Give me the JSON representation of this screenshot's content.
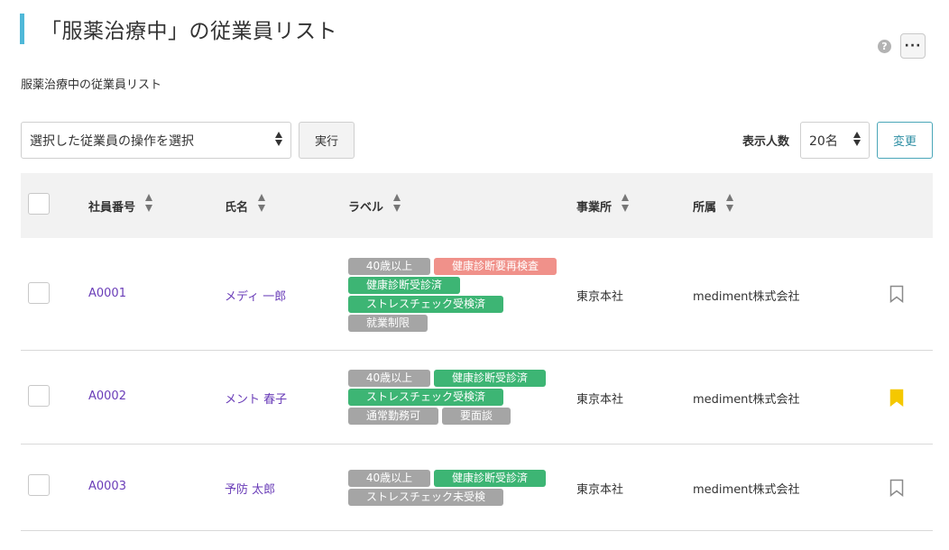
{
  "page": {
    "title": "「服薬治療中」の従業員リスト",
    "subtitle": "服薬治療中の従業員リスト",
    "help_icon": "?",
    "more_label": "···"
  },
  "toolbar": {
    "action_select_value": "選択した従業員の操作を選択",
    "exec_label": "実行",
    "count_label": "表示人数",
    "count_value": "20名",
    "change_label": "変更"
  },
  "table": {
    "headers": {
      "employee_id": "社員番号",
      "name": "氏名",
      "label": "ラベル",
      "office": "事業所",
      "department": "所属"
    },
    "rows": [
      {
        "employee_id": "A0001",
        "name": "メディ 一郎",
        "office": "東京本社",
        "department": "mediment株式会社",
        "bookmarked": false,
        "label_lines": [
          [
            {
              "text": "40歳以上",
              "color": "gray"
            },
            {
              "text": "健康診断要再検査",
              "color": "red"
            }
          ],
          [
            {
              "text": "健康診断受診済",
              "color": "green"
            }
          ],
          [
            {
              "text": "ストレスチェック受検済",
              "color": "green"
            }
          ],
          [
            {
              "text": "就業制限",
              "color": "gray"
            }
          ]
        ]
      },
      {
        "employee_id": "A0002",
        "name": "メント 春子",
        "office": "東京本社",
        "department": "mediment株式会社",
        "bookmarked": true,
        "label_lines": [
          [
            {
              "text": "40歳以上",
              "color": "gray"
            },
            {
              "text": "健康診断受診済",
              "color": "green"
            }
          ],
          [
            {
              "text": "ストレスチェック受検済",
              "color": "green"
            }
          ],
          [
            {
              "text": "通常勤務可",
              "color": "gray"
            },
            {
              "text": "要面談",
              "color": "gray"
            }
          ]
        ]
      },
      {
        "employee_id": "A0003",
        "name": "予防 太郎",
        "office": "東京本社",
        "department": "mediment株式会社",
        "bookmarked": false,
        "label_lines": [
          [
            {
              "text": "40歳以上",
              "color": "gray"
            },
            {
              "text": "健康診断受診済",
              "color": "green"
            }
          ],
          [
            {
              "text": "ストレスチェック未受検",
              "color": "gray"
            }
          ]
        ]
      }
    ]
  },
  "colors": {
    "accent": "#4fb8d8",
    "link": "#6a3db8",
    "tag_green": "#3db574",
    "tag_gray": "#a5a5a5",
    "tag_red": "#f0918a",
    "bookmark_active": "#f5c800"
  }
}
